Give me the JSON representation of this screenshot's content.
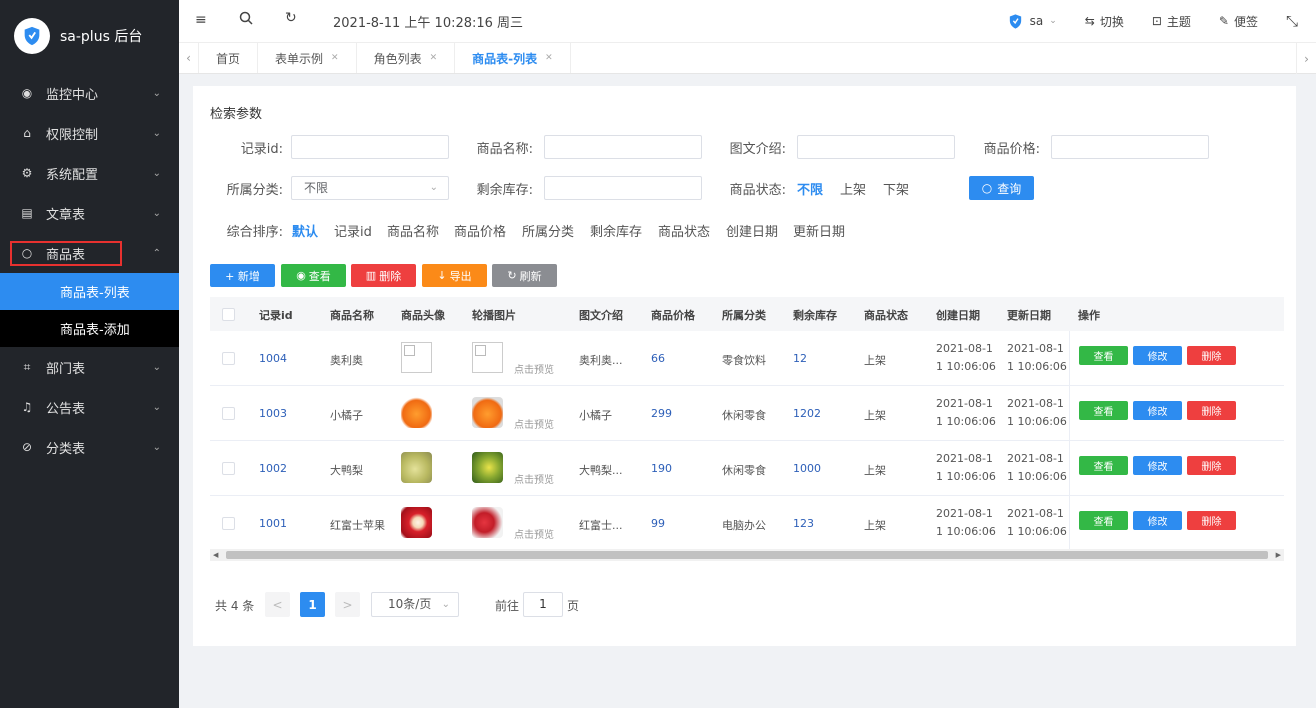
{
  "app": {
    "title": "sa-plus 后台"
  },
  "sidebar": {
    "items": [
      {
        "label": "监控中心",
        "icon": "eye-icon",
        "chev": "⌄"
      },
      {
        "label": "权限控制",
        "icon": "lock-icon",
        "chev": "⌄"
      },
      {
        "label": "系统配置",
        "icon": "gear-icon",
        "chev": "⌄"
      },
      {
        "label": "文章表",
        "icon": "document-icon",
        "chev": "⌄"
      },
      {
        "label": "商品表",
        "icon": "circle-icon",
        "chev": "⌃"
      },
      {
        "label": "部门表",
        "icon": "crop-icon",
        "chev": "⌄"
      },
      {
        "label": "公告表",
        "icon": "bell-icon",
        "chev": "⌄"
      },
      {
        "label": "分类表",
        "icon": "compass-icon",
        "chev": "⌄"
      }
    ],
    "submenu": [
      {
        "label": "商品表-列表"
      },
      {
        "label": "商品表-添加"
      }
    ]
  },
  "header": {
    "datetime": "2021-8-11 上午 10:28:16 周三",
    "user": "sa",
    "actions": [
      {
        "label": "切换"
      },
      {
        "label": "主题"
      },
      {
        "label": "便签"
      }
    ]
  },
  "tabs": [
    {
      "label": "首页"
    },
    {
      "label": "表单示例"
    },
    {
      "label": "角色列表"
    },
    {
      "label": "商品表-列表"
    }
  ],
  "search": {
    "title": "检索参数",
    "fields": {
      "id": {
        "label": "记录id:"
      },
      "name": {
        "label": "商品名称:"
      },
      "intro": {
        "label": "图文介绍:"
      },
      "price": {
        "label": "商品价格:"
      },
      "category": {
        "label": "所属分类:",
        "value": "不限"
      },
      "stock": {
        "label": "剩余库存:"
      },
      "status": {
        "label": "商品状态:",
        "options": [
          "不限",
          "上架",
          "下架"
        ],
        "selected": "不限"
      }
    },
    "button": "查询",
    "sort": {
      "label": "综合排序:",
      "options": [
        "默认",
        "记录id",
        "商品名称",
        "商品价格",
        "所属分类",
        "剩余库存",
        "商品状态",
        "创建日期",
        "更新日期"
      ],
      "selected": "默认"
    }
  },
  "actions": [
    {
      "label": "+ 新增",
      "color": "#2d8cf0"
    },
    {
      "label": "查看",
      "color": "#33b846"
    },
    {
      "label": "删除",
      "color": "#ee3f3f"
    },
    {
      "label": "导出",
      "color": "#fb8a18"
    },
    {
      "label": "刷新",
      "color": "#8b8d92"
    }
  ],
  "table": {
    "headers": [
      "记录id",
      "商品名称",
      "商品头像",
      "轮播图片",
      "图文介绍",
      "商品价格",
      "所属分类",
      "剩余库存",
      "商品状态",
      "创建日期",
      "更新日期",
      "操作"
    ],
    "clickview": "点击预览",
    "rows": [
      {
        "id": "1004",
        "name": "奥利奥",
        "intro": "奥利奥...",
        "price": "66",
        "category": "零食饮料",
        "stock": "12",
        "status": "上架",
        "created1": "2021-08-1",
        "created2": "1 10:06:06",
        "updated1": "2021-08-1",
        "updated2": "1 10:06:06",
        "avatar": "broken",
        "carousel": "broken"
      },
      {
        "id": "1003",
        "name": "小橘子",
        "intro": "小橘子",
        "price": "299",
        "category": "休闲零食",
        "stock": "1202",
        "status": "上架",
        "created1": "2021-08-1",
        "created2": "1 10:06:06",
        "updated1": "2021-08-1",
        "updated2": "1 10:06:06",
        "avatar": "orange",
        "carousel": "orange"
      },
      {
        "id": "1002",
        "name": "大鸭梨",
        "intro": "大鸭梨...",
        "price": "190",
        "category": "休闲零食",
        "stock": "1000",
        "status": "上架",
        "created1": "2021-08-1",
        "created2": "1 10:06:06",
        "updated1": "2021-08-1",
        "updated2": "1 10:06:06",
        "avatar": "pear",
        "carousel": "pear"
      },
      {
        "id": "1001",
        "name": "红富士苹果",
        "intro": "红富士...",
        "price": "99",
        "category": "电脑办公",
        "stock": "123",
        "status": "上架",
        "created1": "2021-08-1",
        "created2": "1 10:06:06",
        "updated1": "2021-08-1",
        "updated2": "1 10:06:06",
        "avatar": "apple",
        "carousel": "apple"
      }
    ],
    "row_actions": [
      {
        "label": "查看",
        "color": "#33b846"
      },
      {
        "label": "修改",
        "color": "#2d8cf0"
      },
      {
        "label": "删除",
        "color": "#ee3f3f"
      }
    ]
  },
  "pager": {
    "total": "共 4 条",
    "prev": "<",
    "next": ">",
    "current": "1",
    "size": "10条/页",
    "jump_label": "前往",
    "jump_value": "1",
    "page_label": "页"
  }
}
